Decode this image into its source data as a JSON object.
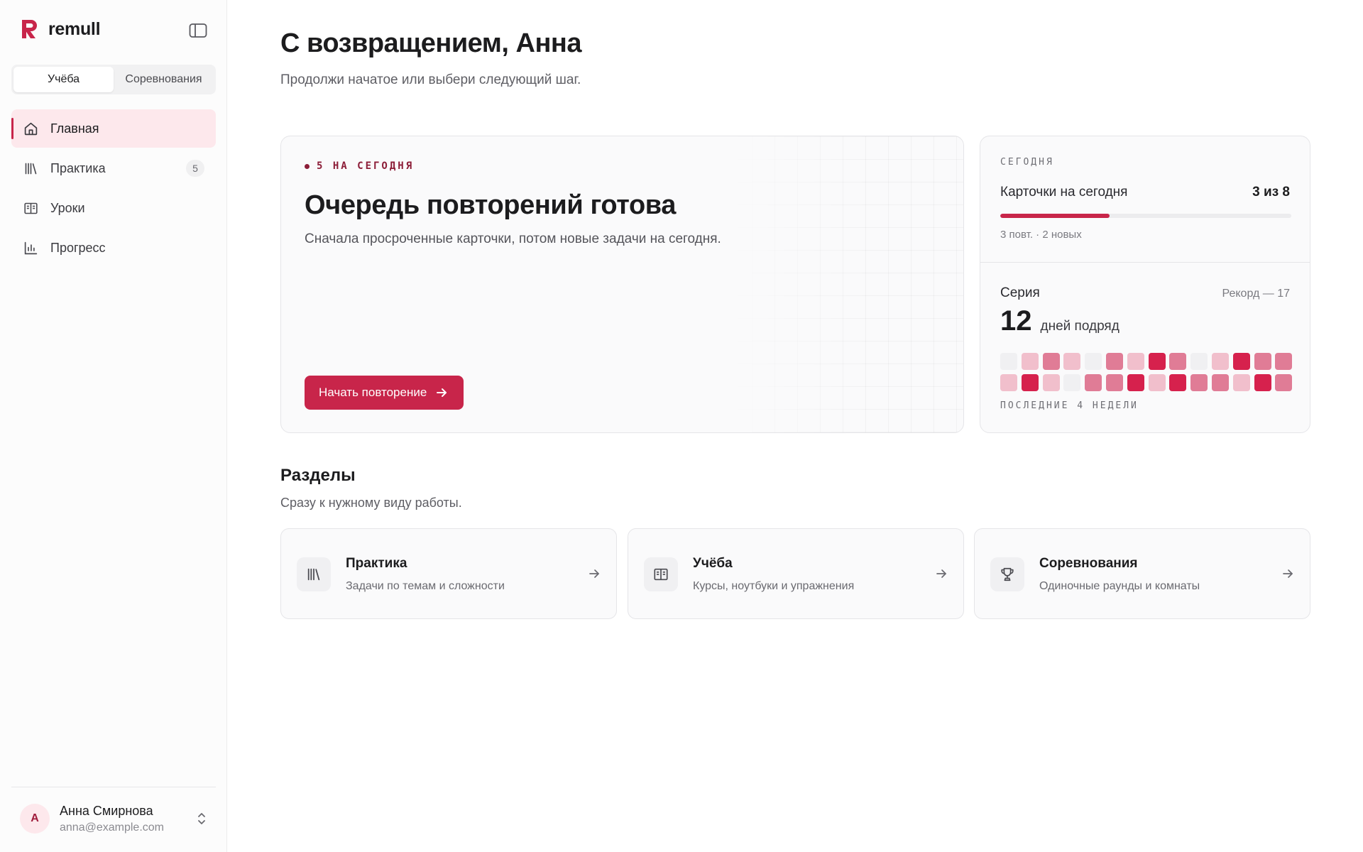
{
  "brand": {
    "name": "remull",
    "accent": "#c8254a"
  },
  "mode_switch": {
    "items": [
      {
        "label": "Учёба",
        "active": true
      },
      {
        "label": "Соревнования",
        "active": false
      }
    ]
  },
  "nav": {
    "items": [
      {
        "label": "Главная",
        "icon": "home-icon",
        "active": true
      },
      {
        "label": "Практика",
        "icon": "library-icon",
        "badge": "5"
      },
      {
        "label": "Уроки",
        "icon": "book-open-icon"
      },
      {
        "label": "Прогресс",
        "icon": "bar-chart-icon"
      }
    ]
  },
  "user": {
    "initial": "А",
    "name": "Анна Смирнова",
    "email": "anna@example.com"
  },
  "header": {
    "title": "С возвращением, Анна",
    "subtitle": "Продолжи начатое или выбери следующий шаг."
  },
  "hero": {
    "eyebrow": "5 НА СЕГОДНЯ",
    "title": "Очередь повторений готова",
    "subtitle": "Сначала просроченные карточки, потом новые задачи на сегодня.",
    "cta": "Начать повторение"
  },
  "today": {
    "label": "СЕГОДНЯ",
    "cards_title": "Карточки на сегодня",
    "cards_count": "3 из 8",
    "progress": 0.375,
    "cards_meta": "3 повт. · 2 новых",
    "streak_title": "Серия",
    "streak_record": "Рекорд — 17",
    "streak_value": "12",
    "streak_unit": "дней подряд",
    "heatmap_caption": "ПОСЛЕДНИЕ 4 НЕДЕЛИ",
    "heatmap_levels": [
      0,
      1,
      2,
      1,
      0,
      2,
      1,
      3,
      2,
      0,
      1,
      3,
      2,
      2,
      1,
      3,
      1,
      0,
      2,
      2,
      3,
      1,
      3,
      2,
      2,
      1,
      3,
      2
    ],
    "heatmap_colors": [
      "#f0f0f2",
      "#f1bfcc",
      "#e07c96",
      "#d6214d"
    ]
  },
  "sections": {
    "title": "Разделы",
    "subtitle": "Сразу к нужному виду работы.",
    "items": [
      {
        "title": "Практика",
        "desc": "Задачи по темам и сложности",
        "icon": "library-icon"
      },
      {
        "title": "Учёба",
        "desc": "Курсы, ноутбуки и упражнения",
        "icon": "book-open-icon"
      },
      {
        "title": "Соревнования",
        "desc": "Одиночные раунды и комнаты",
        "icon": "trophy-icon"
      }
    ]
  }
}
